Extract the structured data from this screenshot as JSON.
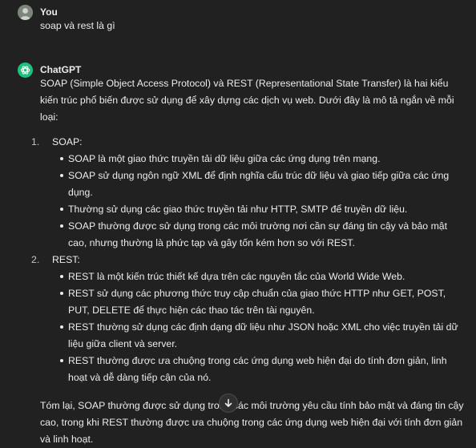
{
  "user_message": {
    "author": "You",
    "text": "soap và rest là gì"
  },
  "assistant_message": {
    "author": "ChatGPT",
    "intro": "SOAP (Simple Object Access Protocol) và REST (Representational State Transfer) là hai kiểu kiến trúc phổ biến được sử dụng để xây dựng các dịch vụ web. Dưới đây là mô tả ngắn về mỗi loại:",
    "sections": [
      {
        "number": "1.",
        "title": "SOAP:",
        "bullets": [
          "SOAP là một giao thức truyền tải dữ liệu giữa các ứng dụng trên mạng.",
          "SOAP sử dụng ngôn ngữ XML để định nghĩa cấu trúc dữ liệu và giao tiếp giữa các ứng dụng.",
          "Thường sử dụng các giao thức truyền tải như HTTP, SMTP để truyền dữ liệu.",
          "SOAP thường được sử dụng trong các môi trường nơi cần sự đáng tin cậy và bảo mật cao, nhưng thường là phức tạp và gây tốn kém hơn so với REST."
        ]
      },
      {
        "number": "2.",
        "title": "REST:",
        "bullets": [
          "REST là một kiến trúc thiết kế dựa trên các nguyên tắc của World Wide Web.",
          "REST sử dụng các phương thức truy cập chuẩn của giao thức HTTP như GET, POST, PUT, DELETE để thực hiện các thao tác trên tài nguyên.",
          "REST thường sử dụng các định dạng dữ liệu như JSON hoặc XML cho việc truyền tải dữ liệu giữa client và server.",
          "REST thường được ưa chuộng trong các ứng dụng web hiện đại do tính đơn giản, linh hoạt và dễ dàng tiếp cận của nó."
        ]
      }
    ],
    "conclusion": "Tóm lại, SOAP thường được sử dụng trong các môi trường yêu cầu tính bảo mật và đáng tin cậy cao, trong khi REST thường được ưa chuộng trong các ứng dụng web hiện đại với tính đơn giản và linh hoạt."
  },
  "icons": {
    "scroll_down": "arrow-down-icon",
    "assistant_logo": "openai-logo-icon",
    "user_avatar": "user-avatar"
  },
  "colors": {
    "background": "#212121",
    "text": "#ececec",
    "assistant_avatar": "#19c37d"
  }
}
